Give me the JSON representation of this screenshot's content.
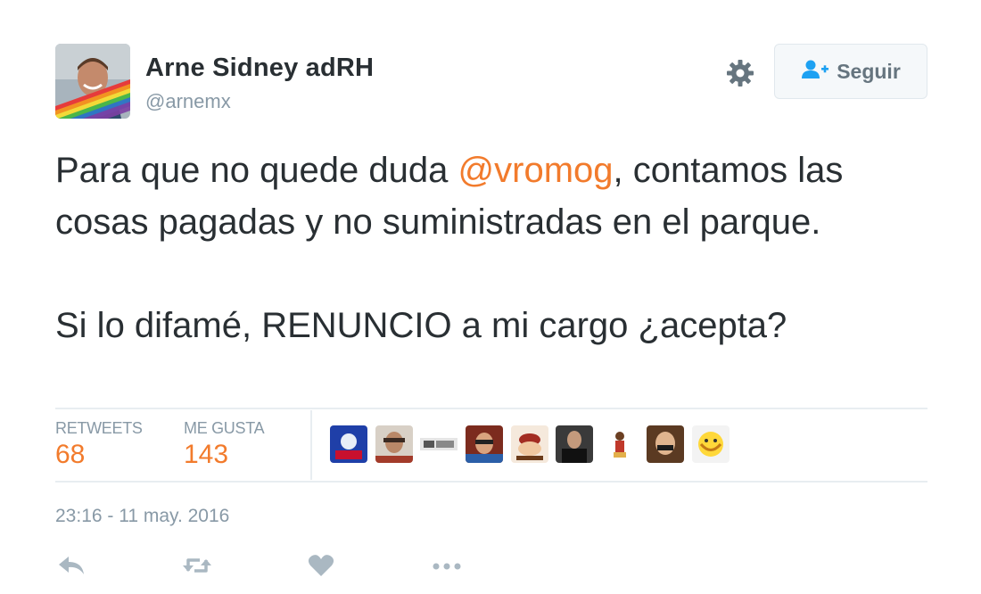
{
  "author": {
    "name": "Arne Sidney adRH",
    "handle": "@arnemx",
    "avatar_icon": "profile-photo-with-rainbow-flag"
  },
  "follow_button": {
    "label": "Seguir",
    "icon": "add-user-icon"
  },
  "settings_icon": "gear-icon",
  "tweet": {
    "paragraphs": [
      {
        "before": "Para que no quede duda ",
        "mention": "@vromog",
        "after": ", contamos las cosas pagadas y no suministradas en el parque."
      },
      {
        "text": "Si lo difamé, RENUNCIO a mi cargo ¿acepta?"
      }
    ]
  },
  "stats": {
    "retweets": {
      "label": "RETWEETS",
      "value": "68"
    },
    "likes": {
      "label": "ME GUSTA",
      "value": "143"
    }
  },
  "likers": [
    "liker-avatar-1",
    "liker-avatar-2",
    "liker-avatar-3",
    "liker-avatar-4",
    "liker-avatar-5",
    "liker-avatar-6",
    "liker-avatar-7",
    "liker-avatar-8",
    "liker-avatar-9"
  ],
  "timestamp": "23:16 - 11 may. 2016",
  "actions": [
    "reply-icon",
    "retweet-icon",
    "like-icon",
    "more-icon"
  ],
  "colors": {
    "accent": "#f27b2c",
    "text": "#292f33",
    "muted": "#8899a6",
    "follow_icon": "#1da1f2"
  }
}
